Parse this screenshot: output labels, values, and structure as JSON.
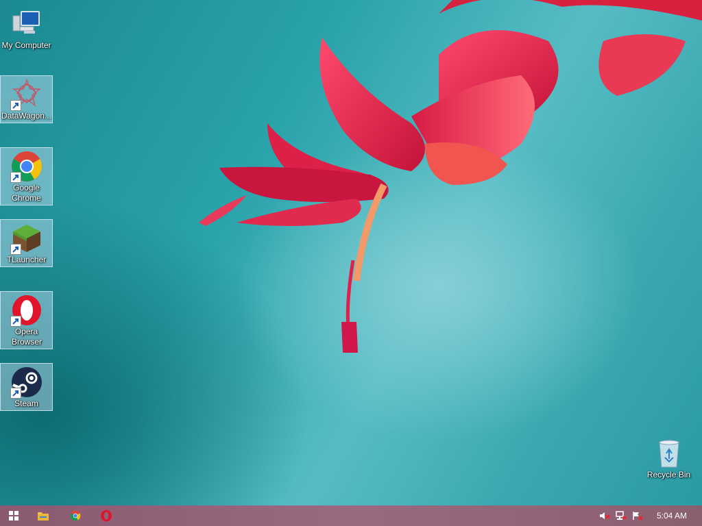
{
  "desktop_icons": [
    {
      "label": "My Computer",
      "icon": "computer-icon"
    },
    {
      "label": "DataWagon...",
      "icon": "datawagon-icon"
    },
    {
      "label": "Google Chrome",
      "icon": "chrome-icon"
    },
    {
      "label": "TLauncher",
      "icon": "tlauncher-icon"
    },
    {
      "label": "Opera Browser",
      "icon": "opera-icon"
    },
    {
      "label": "Steam",
      "icon": "steam-icon"
    }
  ],
  "recycle_bin": {
    "label": "Recycle Bin",
    "icon": "recycle-bin-icon"
  },
  "taskbar": {
    "pinned": [
      "windows-start-icon",
      "file-explorer-icon",
      "chrome-icon",
      "opera-icon"
    ],
    "tray": [
      "volume-muted-icon",
      "network-icon",
      "action-center-icon"
    ],
    "clock": "5:04 AM"
  },
  "colors": {
    "taskbar": "#8f6276",
    "wallpaper_teal": "#2aa3ab",
    "flower": "#e0284f"
  }
}
